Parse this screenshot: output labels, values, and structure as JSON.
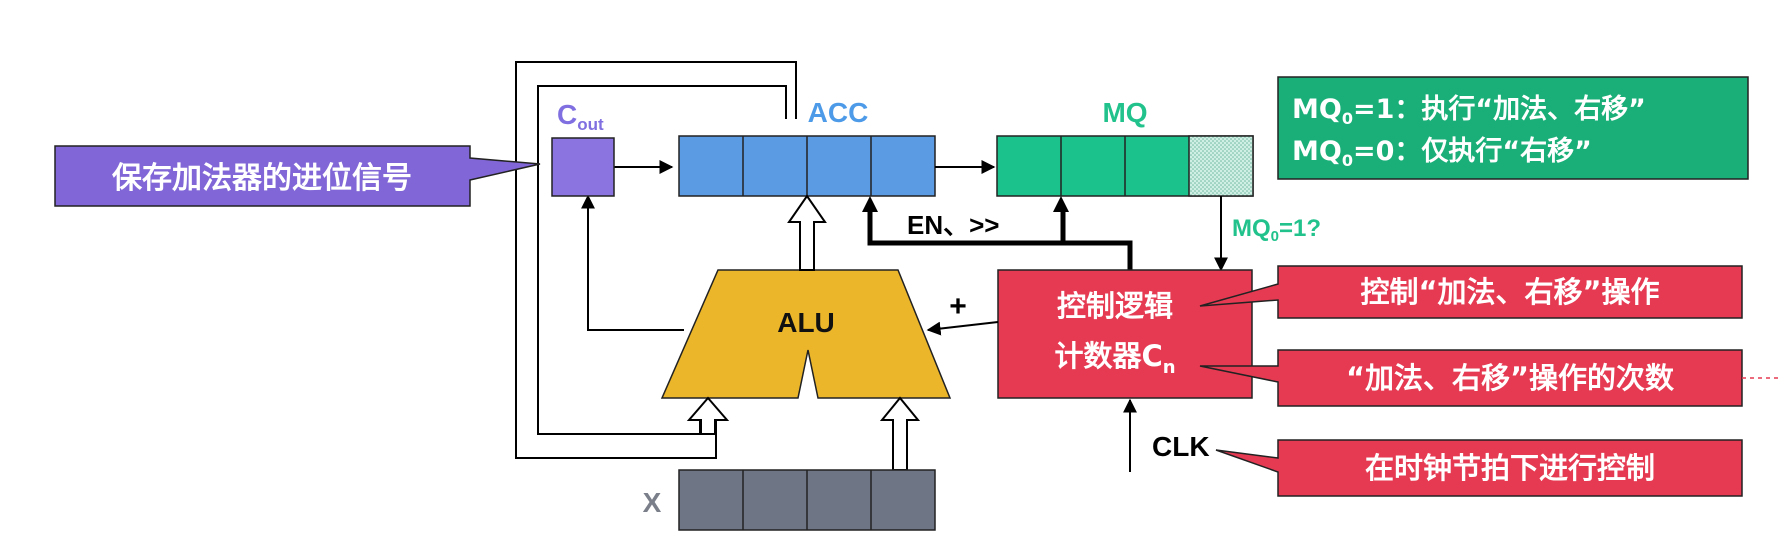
{
  "labels": {
    "cout_main": "C",
    "cout_sub": "out",
    "acc": "ACC",
    "mq": "MQ",
    "alu": "ALU",
    "x": "X",
    "en_shift": "EN、>>",
    "plus": "+",
    "clk": "CLK",
    "mq0_check_pre": "MQ",
    "mq0_check_sub": "0",
    "mq0_check_post": "=1?"
  },
  "control": {
    "line1": "控制逻辑",
    "line2_main": "计数器C",
    "line2_sub": "n"
  },
  "callouts": {
    "carry": "保存加法器的进位信号",
    "mq_rule1_pre": "MQ",
    "mq_rule1_sub": "0",
    "mq_rule1_post": "=1：执行“加法、右移”",
    "mq_rule2_pre": "MQ",
    "mq_rule2_sub": "0",
    "mq_rule2_post": "=0：仅执行“右移”",
    "control_op": "控制“加法、右移”操作",
    "count": "“加法、右移”操作的次数",
    "clock": "在时钟节拍下进行控制"
  },
  "colors": {
    "cout": "#8b74e0",
    "acc": "#5b9be4",
    "mq": "#1cc28c",
    "alu": "#ecb62a",
    "x": "#6e7585",
    "control": "#e53a52",
    "carry_callout": "#8066d6",
    "mq_callout": "#1aae78",
    "cout_label": "#7f6fe0",
    "acc_label": "#4d9be8",
    "mq_label": "#22c28c",
    "x_label": "#7a7f8a"
  }
}
